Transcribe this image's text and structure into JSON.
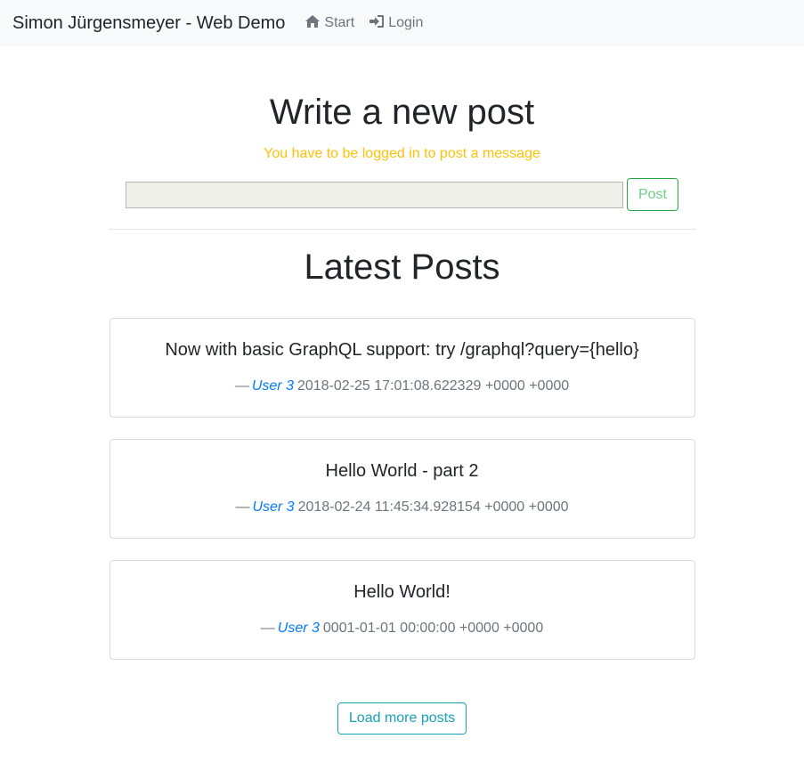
{
  "navbar": {
    "brand": "Simon Jürgensmeyer - Web Demo",
    "items": [
      {
        "label": "Start",
        "icon": "home-icon"
      },
      {
        "label": "Login",
        "icon": "sign-in-icon"
      }
    ]
  },
  "compose": {
    "title": "Write a new post",
    "warning": "You have to be logged in to post a message",
    "input_value": "",
    "post_button": "Post"
  },
  "latest": {
    "title": "Latest Posts",
    "dash": "—",
    "posts": [
      {
        "text": "Now with basic GraphQL support: try /graphql?query={hello}",
        "user": "User 3",
        "timestamp": "2018-02-25 17:01:08.622329 +0000 +0000"
      },
      {
        "text": "Hello World - part 2",
        "user": "User 3",
        "timestamp": "2018-02-24 11:45:34.928154 +0000 +0000"
      },
      {
        "text": "Hello World!",
        "user": "User 3",
        "timestamp": "0001-01-01 00:00:00 +0000 +0000"
      }
    ],
    "load_more": "Load more posts"
  },
  "colors": {
    "navbar_bg": "#f8f9fa",
    "warning": "#ffc107",
    "link": "#007bff",
    "success": "#28a745",
    "info": "#17a2b8",
    "muted": "#6c757d"
  }
}
